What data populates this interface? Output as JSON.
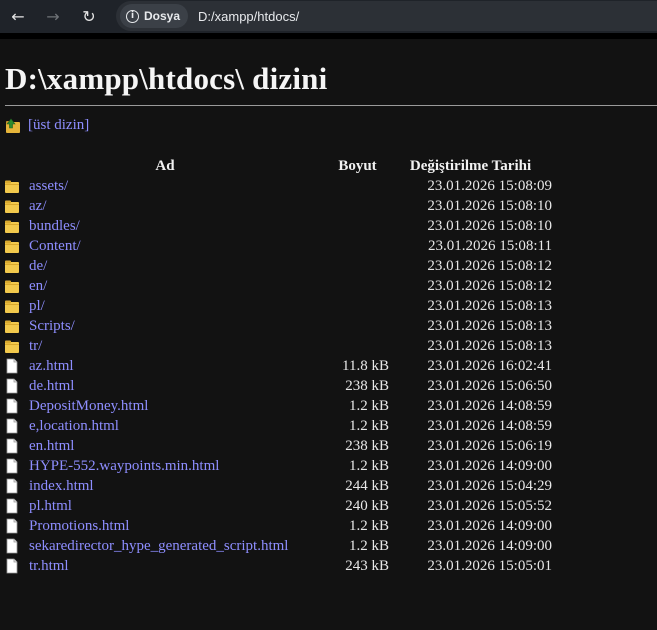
{
  "browser": {
    "back_icon": "←",
    "forward_icon": "→",
    "reload_icon": "↻",
    "site_info_label": "Dosya",
    "address": "D:/xampp/htdocs/"
  },
  "page": {
    "heading": "D:\\xampp\\htdocs\\ dizini",
    "parent_link": "[üst dizin]"
  },
  "table": {
    "headers": {
      "name": "Ad",
      "size": "Boyut",
      "modified": "Değiştirilme Tarihi"
    },
    "rows": [
      {
        "name": "assets/",
        "size": "",
        "modified": "23.01.2026 15:08:09",
        "type": "folder"
      },
      {
        "name": "az/",
        "size": "",
        "modified": "23.01.2026 15:08:10",
        "type": "folder"
      },
      {
        "name": "bundles/",
        "size": "",
        "modified": "23.01.2026 15:08:10",
        "type": "folder"
      },
      {
        "name": "Content/",
        "size": "",
        "modified": "23.01.2026 15:08:11",
        "type": "folder"
      },
      {
        "name": "de/",
        "size": "",
        "modified": "23.01.2026 15:08:12",
        "type": "folder"
      },
      {
        "name": "en/",
        "size": "",
        "modified": "23.01.2026 15:08:12",
        "type": "folder"
      },
      {
        "name": "pl/",
        "size": "",
        "modified": "23.01.2026 15:08:13",
        "type": "folder"
      },
      {
        "name": "Scripts/",
        "size": "",
        "modified": "23.01.2026 15:08:13",
        "type": "folder"
      },
      {
        "name": "tr/",
        "size": "",
        "modified": "23.01.2026 15:08:13",
        "type": "folder"
      },
      {
        "name": "az.html",
        "size": "11.8 kB",
        "modified": "23.01.2026 16:02:41",
        "type": "file"
      },
      {
        "name": "de.html",
        "size": "238 kB",
        "modified": "23.01.2026 15:06:50",
        "type": "file"
      },
      {
        "name": "DepositMoney.html",
        "size": "1.2 kB",
        "modified": "23.01.2026 14:08:59",
        "type": "file"
      },
      {
        "name": "e,location.html",
        "size": "1.2 kB",
        "modified": "23.01.2026 14:08:59",
        "type": "file"
      },
      {
        "name": "en.html",
        "size": "238 kB",
        "modified": "23.01.2026 15:06:19",
        "type": "file"
      },
      {
        "name": "HYPE-552.waypoints.min.html",
        "size": "1.2 kB",
        "modified": "23.01.2026 14:09:00",
        "type": "file"
      },
      {
        "name": "index.html",
        "size": "244 kB",
        "modified": "23.01.2026 15:04:29",
        "type": "file"
      },
      {
        "name": "pl.html",
        "size": "240 kB",
        "modified": "23.01.2026 15:05:52",
        "type": "file"
      },
      {
        "name": "Promotions.html",
        "size": "1.2 kB",
        "modified": "23.01.2026 14:09:00",
        "type": "file"
      },
      {
        "name": "sekaredirector_hype_generated_script.html",
        "size": "1.2 kB",
        "modified": "23.01.2026 14:09:00",
        "type": "file"
      },
      {
        "name": "tr.html",
        "size": "243 kB",
        "modified": "23.01.2026 15:05:01",
        "type": "file"
      }
    ]
  },
  "colors": {
    "link": "#8e8eff",
    "folder": "#f2c94c",
    "background": "#121212"
  }
}
